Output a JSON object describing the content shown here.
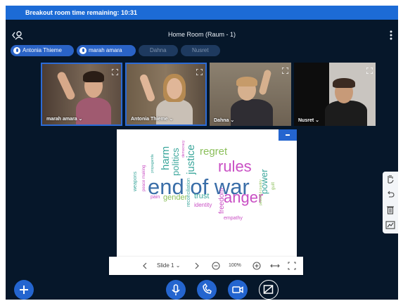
{
  "banner": {
    "text": "Breakout room time remaining: 10:31"
  },
  "header": {
    "room_title": "Home Room (Raum - 1)"
  },
  "talking_pills": [
    {
      "label": "Antonia Thieme",
      "active": true
    },
    {
      "label": "marah amara",
      "active": true
    },
    {
      "label": "Dahna",
      "active": false
    },
    {
      "label": "Nusret",
      "active": false
    }
  ],
  "videos": [
    {
      "name": "marah amara",
      "speaking": true
    },
    {
      "name": "Antonia Thieme",
      "speaking": true
    },
    {
      "name": "Dahna",
      "speaking": false
    },
    {
      "name": "Nusret",
      "speaking": false
    }
  ],
  "slide": {
    "wordcloud": [
      "end of war",
      "rules",
      "anger",
      "regret",
      "justice",
      "politics",
      "harm",
      "power",
      "gender",
      "trust",
      "freedom",
      "identity",
      "reconciliation",
      "democracy",
      "weapons",
      "peace making",
      "propaganda",
      "pain",
      "empathy",
      "peaceful country",
      "guilt"
    ]
  },
  "slide_toolbar": {
    "slide_label": "Slide 1",
    "zoom": "100%"
  },
  "colors": {
    "frame_bg": "#06172a",
    "primary": "#2465cf",
    "cloud_teal": "#3aa69b",
    "cloud_green": "#8bbf5a",
    "cloud_purple": "#c94fc4",
    "cloud_blue": "#3a6ea8"
  },
  "icons": {
    "user_list": "user-list-icon",
    "options": "more-vertical-icon",
    "fullscreen": "fullscreen-icon",
    "mic": "microphone-icon",
    "phone": "phone-icon",
    "camera": "video-camera-icon",
    "screenshare": "screenshare-off-icon",
    "plus": "plus-icon",
    "hand": "hand-icon",
    "undo": "undo-icon",
    "trash": "trash-icon",
    "chart": "chart-icon"
  }
}
